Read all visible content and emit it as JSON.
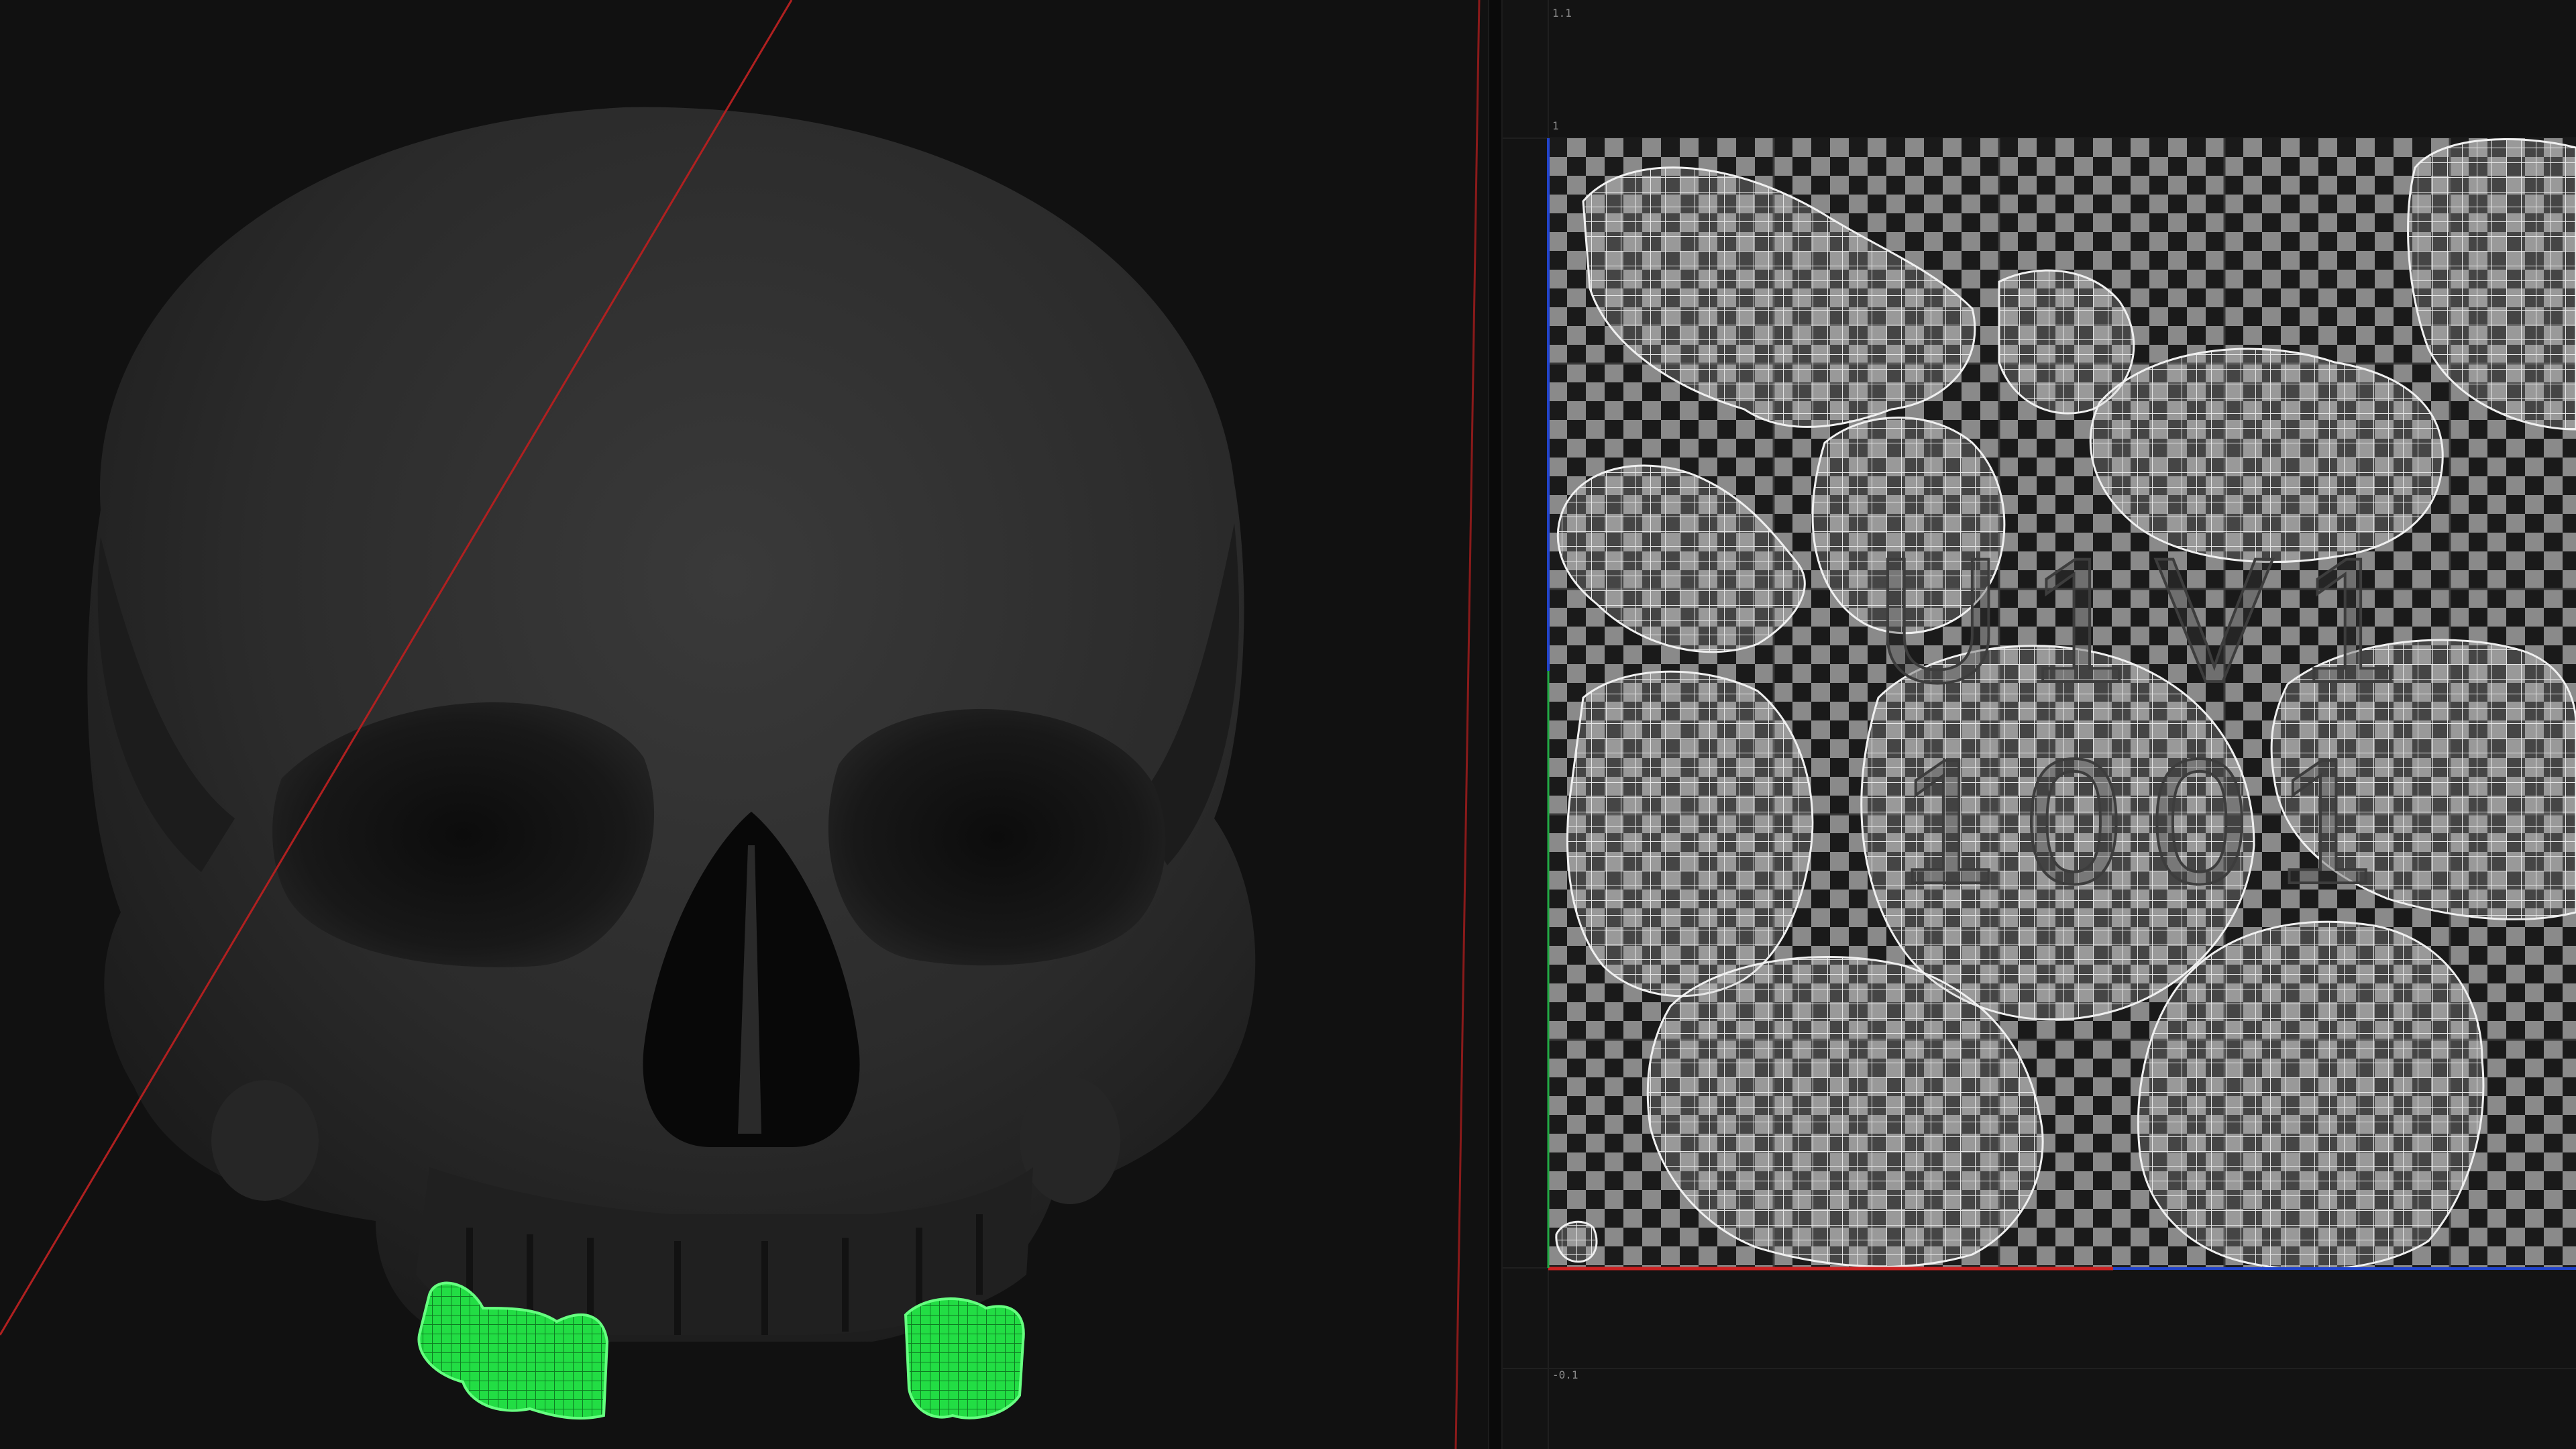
{
  "viewport": {
    "object": "skull-mesh",
    "selection_color": "#33ff55",
    "background": "#111111"
  },
  "uv_editor": {
    "tile_label_line1": "U1V1",
    "tile_label_line2": "1001",
    "axis_label_top": "1.1",
    "axis_label_one": "1",
    "axis_label_bottom": "-0.1",
    "u_axis_color": "#cc2222",
    "v_axis_color": "#2244cc",
    "checker_light": "#8a8a8a",
    "checker_dark": "#1a1a1a"
  }
}
